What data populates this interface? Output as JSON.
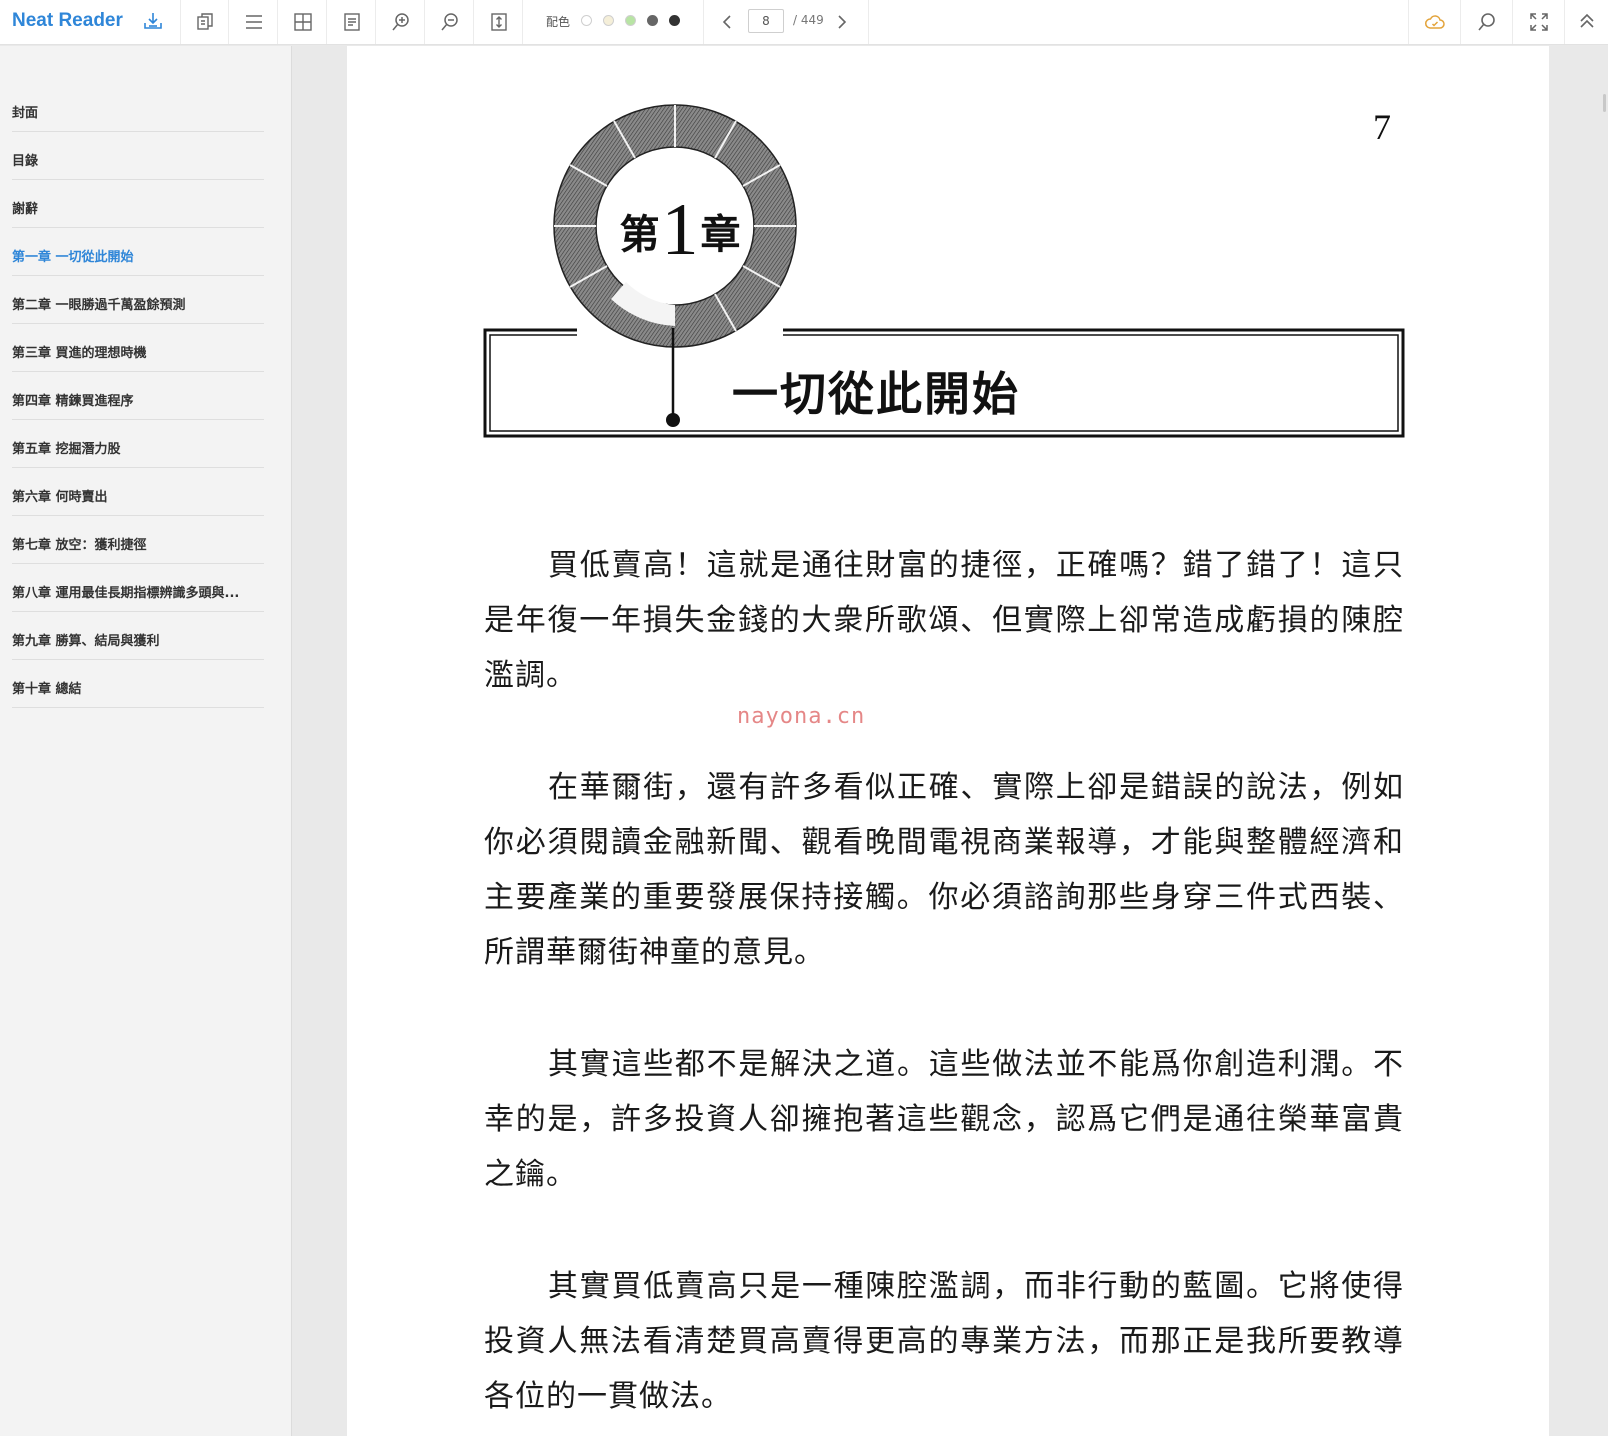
{
  "app": {
    "brand": "Neat Reader",
    "accent_color": "#2f86d8"
  },
  "toolbar": {
    "tools": [
      {
        "name": "copy-icon"
      },
      {
        "name": "menu-icon"
      },
      {
        "name": "grid-icon"
      },
      {
        "name": "notes-icon"
      },
      {
        "name": "zoom-in-icon"
      },
      {
        "name": "zoom-out-icon"
      },
      {
        "name": "fit-height-icon"
      }
    ],
    "theme_label": "配色",
    "theme_colors": [
      "#ffffff",
      "#f5efd9",
      "#b8e4a4",
      "#666666",
      "#333333"
    ],
    "page_current": "8",
    "page_total": "/ 449",
    "right_tools": [
      {
        "name": "cloud-icon",
        "color": "#e3a33a"
      },
      {
        "name": "search-icon"
      },
      {
        "name": "fullscreen-icon"
      },
      {
        "name": "collapse-up-icon"
      }
    ]
  },
  "sidebar": {
    "active_index": 3,
    "items": [
      {
        "label": "封面"
      },
      {
        "label": "目錄"
      },
      {
        "label": "謝辭"
      },
      {
        "label": "第一章 一切從此開始"
      },
      {
        "label": "第二章 一眼勝過千萬盈餘預測"
      },
      {
        "label": "第三章 買進的理想時機"
      },
      {
        "label": "第四章 精鍊買進程序"
      },
      {
        "label": "第五章 挖掘潛力股"
      },
      {
        "label": "第六章 何時賣出"
      },
      {
        "label": "第七章 放空：獲利捷徑"
      },
      {
        "label": "第八章 運用最佳長期指標辨識多頭與..."
      },
      {
        "label": "第九章 勝算、結局與獲利"
      },
      {
        "label": "第十章 總結"
      }
    ]
  },
  "page": {
    "page_number": "7",
    "chapter_prefix": "第",
    "chapter_number": "1",
    "chapter_suffix": "章",
    "chapter_title": "一切從此開始",
    "watermark": "nayona.cn",
    "paragraphs": [
      "買低賣高！這就是通往財富的捷徑，正確嗎？錯了錯了！這只是年復一年損失金錢的大衆所歌頌、但實際上卻常造成虧損的陳腔濫調。",
      "在華爾街，還有許多看似正確、實際上卻是錯誤的說法，例如你必須閱讀金融新聞、觀看晚間電視商業報導，才能與整體經濟和主要產業的重要發展保持接觸。你必須諮詢那些身穿三件式西裝、所謂華爾街神童的意見。",
      "其實這些都不是解決之道。這些做法並不能爲你創造利潤。不幸的是，許多投資人卻擁抱著這些觀念，認爲它們是通往榮華富貴之鑰。",
      "其實買低賣高只是一種陳腔濫調，而非行動的藍圖。它將使得投資人無法看清楚買高賣得更高的專業方法，而那正是我所要教導各位的一貫做法。"
    ]
  }
}
